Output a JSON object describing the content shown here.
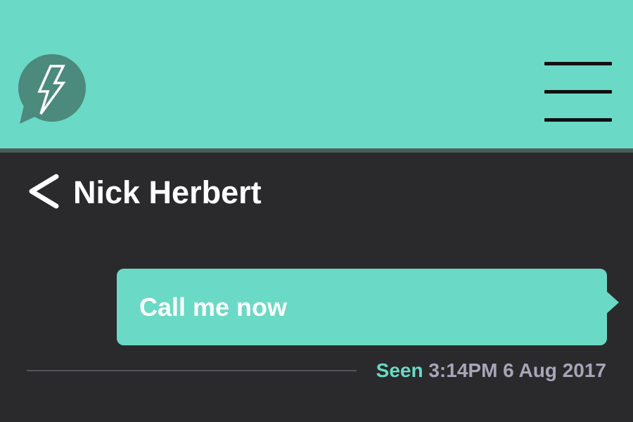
{
  "header": {
    "logo_icon": "chat-bubble-lightning-icon",
    "menu_icon": "hamburger-menu-icon",
    "colors": {
      "bar": "#6ad9c6",
      "logo_bubble": "#4b8a7d"
    }
  },
  "conversation": {
    "back_icon": "chevron-left-icon",
    "contact_name": "Nick Herbert"
  },
  "messages": [
    {
      "text": "Call me now",
      "direction": "outgoing",
      "status": "Seen",
      "timestamp": "3:14PM 6 Aug 2017"
    }
  ],
  "colors": {
    "background": "#2a292b",
    "accent": "#6ad9c6",
    "timestamp": "#a9a5b8",
    "text": "#ffffff"
  }
}
